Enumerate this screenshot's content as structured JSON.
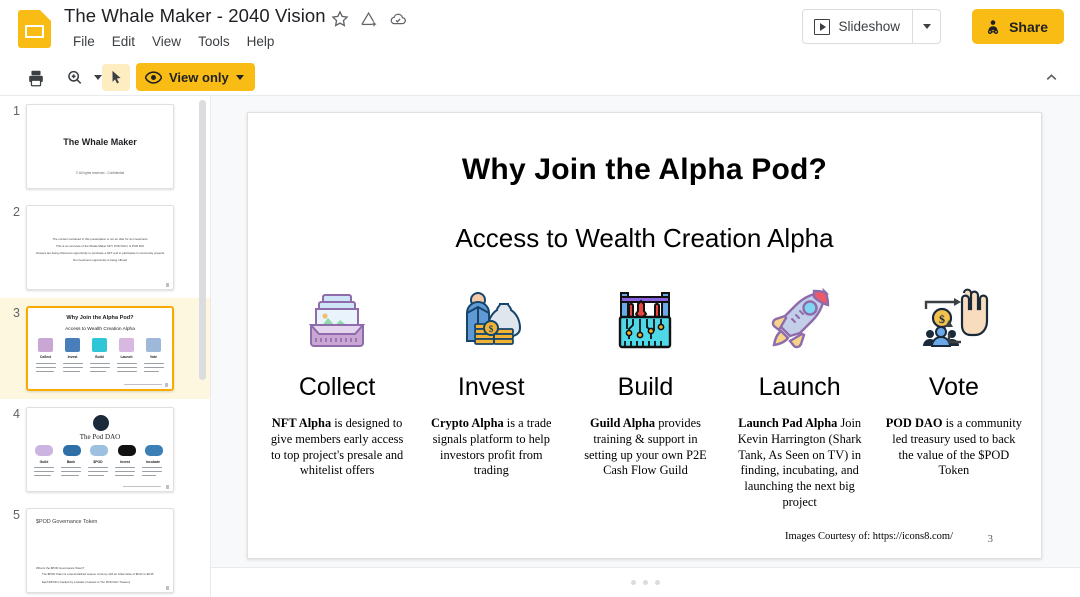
{
  "app": {
    "logo_icon": "slides-logo-icon",
    "document_title": "The Whale Maker - 2040 Vision",
    "title_icons": [
      "star-icon",
      "move-to-folder-icon",
      "cloud-saved-icon"
    ],
    "menus": [
      "File",
      "Edit",
      "View",
      "Tools",
      "Help"
    ],
    "trend_icon": "activity-trend-icon",
    "slideshow_label": "Slideshow",
    "slideshow_icon": "play-icon",
    "slideshow_caret_icon": "chevron-down-icon",
    "share_label": "Share",
    "share_icon": "person-share-icon",
    "share_color": "#F9BC14"
  },
  "toolbar": {
    "print_icon": "print-icon",
    "zoom_icon": "zoom-in-icon",
    "zoom_caret_icon": "chevron-down-icon",
    "cursor_icon": "select-cursor-icon",
    "view_only_label": "View only",
    "view_only_icon": "eye-icon",
    "view_only_caret_icon": "chevron-down-icon",
    "view_only_color": "#F9BC14",
    "collapse_icon": "chevron-up-icon"
  },
  "filmstrip": {
    "selected_index": 3,
    "selection_color": "#F9AB00",
    "slides": [
      {
        "number": "1",
        "title": "The Whale Maker",
        "footer": "© All rights reserved - Confidential"
      },
      {
        "number": "2",
        "lines": [
          "The content contained in this presentation is not an offer for an investment",
          "This is an overview of the Whale Maker NFT, POD DAO, & POD IDO",
          "Viewers are being offered an opportunity to purchase a NFT and to participate in community projects",
          "No investment opportunity is being offered"
        ]
      },
      {
        "number": "3",
        "title": "Why Join the Alpha Pod?",
        "subtitle": "Access to Wealth Creation Alpha",
        "labels": [
          "Collect",
          "Invest",
          "Build",
          "Launch",
          "Vote"
        ]
      },
      {
        "number": "4",
        "title": "The Pod DAO",
        "labels": [
          "Guild",
          "Bank",
          "$POD",
          "Invest",
          "Incubate"
        ]
      },
      {
        "number": "5",
        "title": "$POD Governance Token",
        "lines": [
          "What is the $POD Governance Token?",
          "The $POD Token is a decentralized reserve currency with an initial value of $0.01 to $0.05",
          "Each $POD is backed by a basket of assets in The POD DAO Treasury"
        ]
      }
    ]
  },
  "slide": {
    "heading": "Why Join the Alpha Pod?",
    "subheading": "Access to Wealth Creation Alpha",
    "credits": "Images Courtesy of: https://icons8.com/",
    "page_number": "3",
    "columns": [
      {
        "icon": "nft-gallery-box-icon",
        "title": "Collect",
        "body_bold": "NFT Alpha",
        "body_rest": " is designed to give members early access to top project's presale and whitelist offers"
      },
      {
        "icon": "investor-money-bag-icon",
        "title": "Invest",
        "body_bold": "Crypto Alpha",
        "body_rest": " is a trade signals platform to help investors profit from trading"
      },
      {
        "icon": "toolbox-circuit-icon",
        "title": "Build",
        "body_bold": "Guild Alpha",
        "body_rest": " provides training & support in setting up your own P2E Cash Flow Guild"
      },
      {
        "icon": "rocket-launch-icon",
        "title": "Launch",
        "body_bold": "Launch Pad Alpha",
        "body_rest": " Join Kevin Harrington (Shark Tank, As Seen on TV) in finding, incubating, and launching the next big project"
      },
      {
        "icon": "community-vote-hand-icon",
        "title": "Vote",
        "body_bold": "POD DAO",
        "body_rest": " is a community led treasury used to back the value of the $POD Token"
      }
    ]
  },
  "notes": {
    "handle_icon": "drag-dots-icon"
  }
}
